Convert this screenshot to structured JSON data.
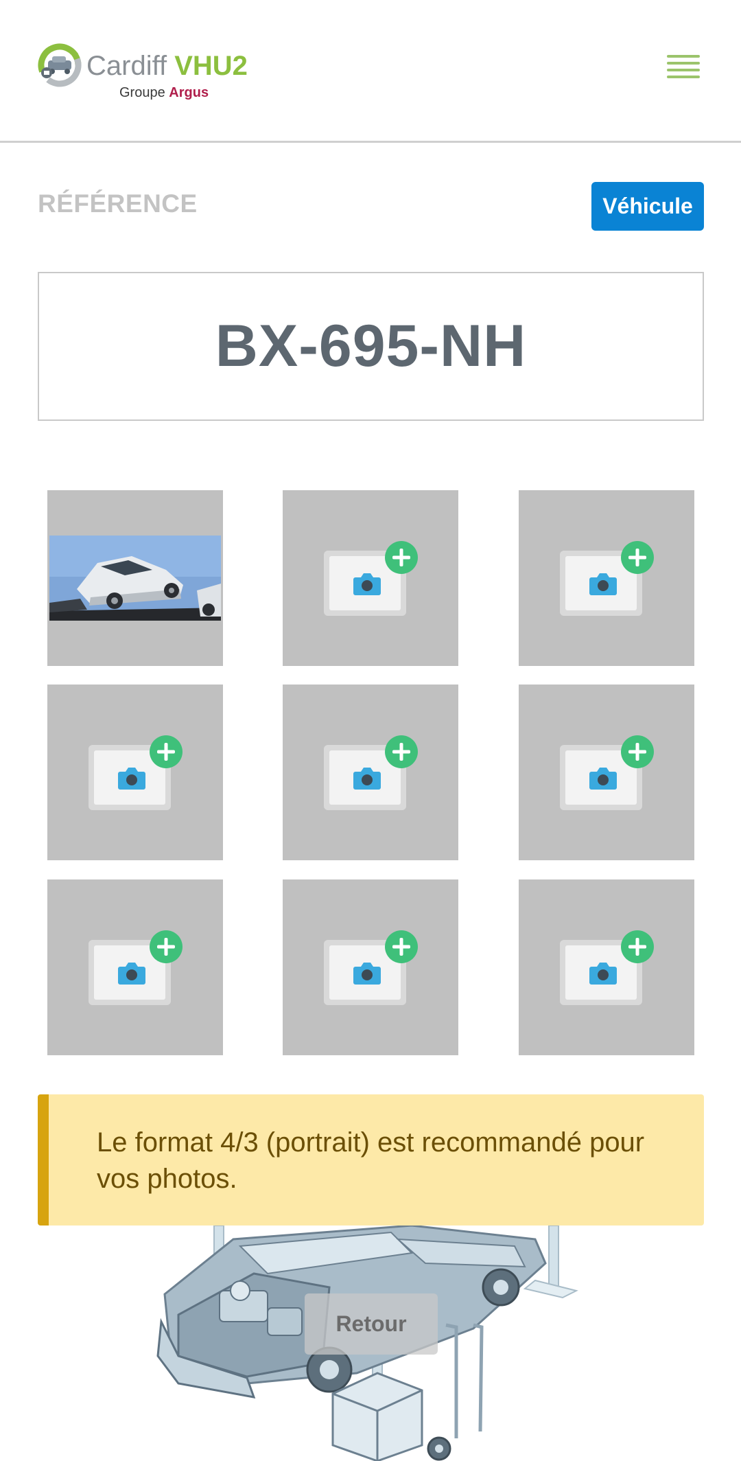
{
  "header": {
    "logo_cardiff": "Cardiff",
    "logo_vhu": "VHU2",
    "logo_groupe": "Groupe",
    "logo_argus": "Argus",
    "menu_icon": "hamburger-menu-icon"
  },
  "reference": {
    "label": "RÉFÉRENCE",
    "vehicle_button": "Véhicule",
    "plate": "BX-695-NH"
  },
  "photos": {
    "slots": [
      {
        "state": "photo"
      },
      {
        "state": "empty",
        "icon": "add-photo-icon"
      },
      {
        "state": "empty",
        "icon": "add-photo-icon"
      },
      {
        "state": "empty",
        "icon": "add-photo-icon"
      },
      {
        "state": "empty",
        "icon": "add-photo-icon"
      },
      {
        "state": "empty",
        "icon": "add-photo-icon"
      },
      {
        "state": "empty",
        "icon": "add-photo-icon"
      },
      {
        "state": "empty",
        "icon": "add-photo-icon"
      },
      {
        "state": "empty",
        "icon": "add-photo-icon"
      }
    ]
  },
  "notice": {
    "text": "Le format 4/3 (portrait) est recommandé pour vos photos."
  },
  "footer": {
    "back_button": "Retour"
  },
  "colors": {
    "brand_green": "#8cbf3f",
    "brand_red": "#b01e4b",
    "primary_blue": "#0a83d4",
    "plus_green": "#3fc07a",
    "camera_blue": "#3aa9de",
    "notice_bg": "#fde9a8",
    "notice_border": "#d7a40f"
  }
}
